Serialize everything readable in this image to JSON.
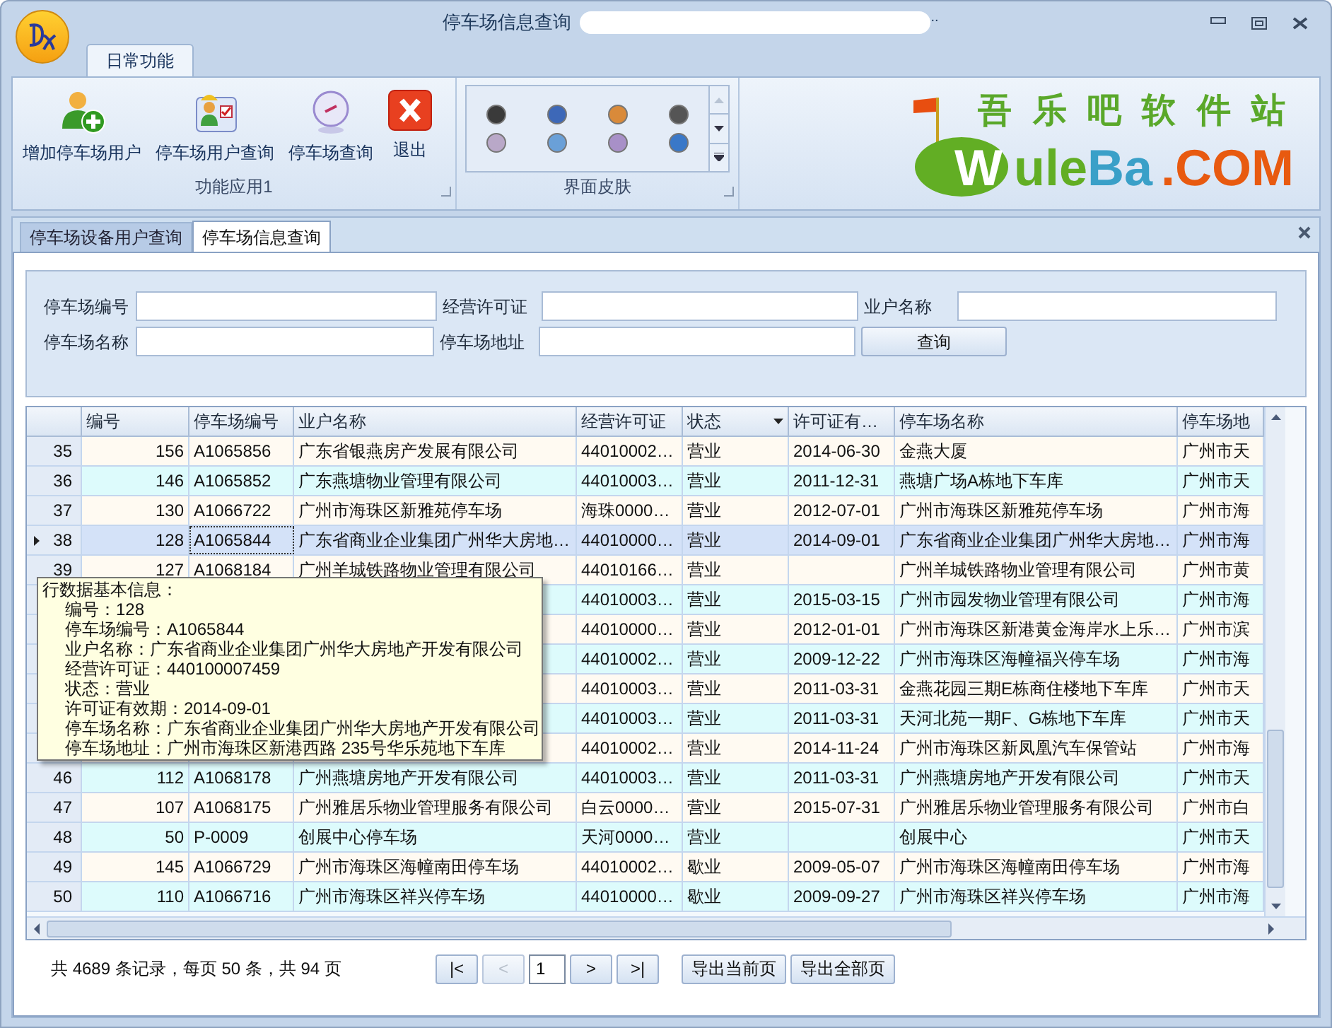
{
  "window": {
    "title": "停车场信息查询",
    "title_suffix": ".."
  },
  "ribbon": {
    "tabs": [
      {
        "label": "日常功能",
        "selected": true
      }
    ],
    "groups": [
      {
        "kind": "buttons",
        "label": "功能应用1",
        "buttons": [
          {
            "label": "增加停车场用户"
          },
          {
            "label": "停车场用户查询"
          },
          {
            "label": "停车场查询"
          },
          {
            "label": "退出"
          }
        ]
      },
      {
        "kind": "gallery",
        "label": "界面皮肤",
        "swatches": [
          {
            "color": "#3a3a3a"
          },
          {
            "color": "#3d68b8"
          },
          {
            "color": "#d98a3a"
          },
          {
            "color": "#555555"
          },
          {
            "color": "#b9a8c8"
          },
          {
            "color": "#6aa0d8"
          },
          {
            "color": "#a890c8"
          },
          {
            "color": "#3a78c8"
          }
        ]
      }
    ]
  },
  "logo": {
    "tagline": "吾 乐 吧 软 件 站",
    "brand_a": "W",
    "brand_b": "ule",
    "brand_c": "Ba",
    "brand_d": ".COM"
  },
  "doc_tabs": [
    {
      "label": "停车场设备用户查询",
      "selected": false
    },
    {
      "label": "停车场信息查询",
      "selected": true
    }
  ],
  "filters": [
    {
      "label": "停车场编号"
    },
    {
      "label": "经营许可证"
    },
    {
      "label": "业户名称"
    },
    {
      "label": "停车场名称"
    },
    {
      "label": "停车场地址"
    }
  ],
  "query_button": "查询",
  "table": {
    "columns": [
      "",
      "编号",
      "停车场编号",
      "业户名称",
      "经营许可证",
      "状态",
      "许可证有…",
      "停车场名称",
      "停车场地"
    ],
    "rows": [
      {
        "selected": false,
        "cells": [
          "35",
          "156",
          "A1065856",
          "广东省银燕房产发展有限公司",
          "44010002…",
          "营业",
          "2014-06-30",
          "金燕大厦",
          "广州市天"
        ]
      },
      {
        "selected": false,
        "cells": [
          "36",
          "146",
          "A1065852",
          "广东燕塘物业管理有限公司",
          "44010003…",
          "营业",
          "2011-12-31",
          "燕塘广场A栋地下车库",
          "广州市天"
        ]
      },
      {
        "selected": false,
        "cells": [
          "37",
          "130",
          "A1066722",
          "广州市海珠区新雅苑停车场",
          "海珠0000…",
          "营业",
          "2012-07-01",
          "广州市海珠区新雅苑停车场",
          "广州市海"
        ]
      },
      {
        "selected": true,
        "cells": [
          "38",
          "128",
          "A1065844",
          "广东省商业企业集团广州华大房地…",
          "44010000…",
          "营业",
          "2014-09-01",
          "广东省商业企业集团广州华大房地…",
          "广州市海"
        ]
      },
      {
        "selected": false,
        "cells": [
          "39",
          "127",
          "A1068184",
          "广州羊城铁路物业管理有限公司",
          "44010166…",
          "营业",
          null,
          "广州羊城铁路物业管理有限公司",
          "广州市黄"
        ]
      },
      {
        "selected": false,
        "cells": [
          null,
          null,
          null,
          null,
          "44010003…",
          "营业",
          "2015-03-15",
          "广州市园发物业管理有限公司",
          "广州市海"
        ]
      },
      {
        "selected": false,
        "cells": [
          null,
          null,
          null,
          null,
          "44010000…",
          "营业",
          "2012-01-01",
          "广州市海珠区新港黄金海岸水上乐…",
          "广州市滨"
        ]
      },
      {
        "selected": false,
        "cells": [
          null,
          null,
          null,
          null,
          "44010002…",
          "营业",
          "2009-12-22",
          "广州市海珠区海幢福兴停车场",
          "广州市海"
        ]
      },
      {
        "selected": false,
        "cells": [
          null,
          null,
          null,
          null,
          "44010003…",
          "营业",
          "2011-03-31",
          "金燕花园三期E栋商住楼地下车库",
          "广州市天"
        ]
      },
      {
        "selected": false,
        "cells": [
          null,
          null,
          null,
          null,
          "44010003…",
          "营业",
          "2011-03-31",
          "天河北苑一期F、G栋地下车库",
          "广州市天"
        ]
      },
      {
        "selected": false,
        "cells": [
          null,
          null,
          null,
          null,
          "44010002…",
          "营业",
          "2014-11-24",
          "广州市海珠区新凤凰汽车保管站",
          "广州市海"
        ]
      },
      {
        "selected": false,
        "cells": [
          "46",
          "112",
          "A1068178",
          "广州燕塘房地产开发有限公司",
          "44010003…",
          "营业",
          "2011-03-31",
          "广州燕塘房地产开发有限公司",
          "广州市天"
        ]
      },
      {
        "selected": false,
        "cells": [
          "47",
          "107",
          "A1068175",
          "广州雅居乐物业管理服务有限公司",
          "白云0000…",
          "营业",
          "2015-07-31",
          "广州雅居乐物业管理服务有限公司",
          "广州市白"
        ]
      },
      {
        "selected": false,
        "cells": [
          "48",
          "50",
          "P-0009",
          "创展中心停车场",
          "天河0000…",
          "营业",
          null,
          "创展中心",
          "广州市天"
        ]
      },
      {
        "selected": false,
        "cells": [
          "49",
          "145",
          "A1066729",
          "广州市海珠区海幢南田停车场",
          "44010002…",
          "歇业",
          "2009-05-07",
          "广州市海珠区海幢南田停车场",
          "广州市海"
        ]
      },
      {
        "selected": false,
        "cells": [
          "50",
          "110",
          "A1066716",
          "广州市海珠区祥兴停车场",
          "44010000…",
          "歇业",
          "2009-09-27",
          "广州市海珠区祥兴停车场",
          "广州市海"
        ]
      }
    ]
  },
  "tooltip": {
    "title": "行数据基本信息：",
    "lines": [
      "编号：128",
      "停车场编号：A1065844",
      "业户名称：广东省商业企业集团广州华大房地产开发有限公司",
      "经营许可证：440100007459",
      "状态：营业",
      "许可证有效期：2014-09-01",
      "停车场名称：广东省商业企业集团广州华大房地产开发有限公司",
      "停车场地址：广州市海珠区新港西路 235号华乐苑地下车库"
    ]
  },
  "pager": {
    "summary": "共 4689 条记录，每页 50 条，共 94 页",
    "first": "|<",
    "prev": "<",
    "prev_disabled": true,
    "page": "1",
    "next": ">",
    "last": ">|",
    "export_page": "导出当前页",
    "export_all": "导出全部页"
  }
}
